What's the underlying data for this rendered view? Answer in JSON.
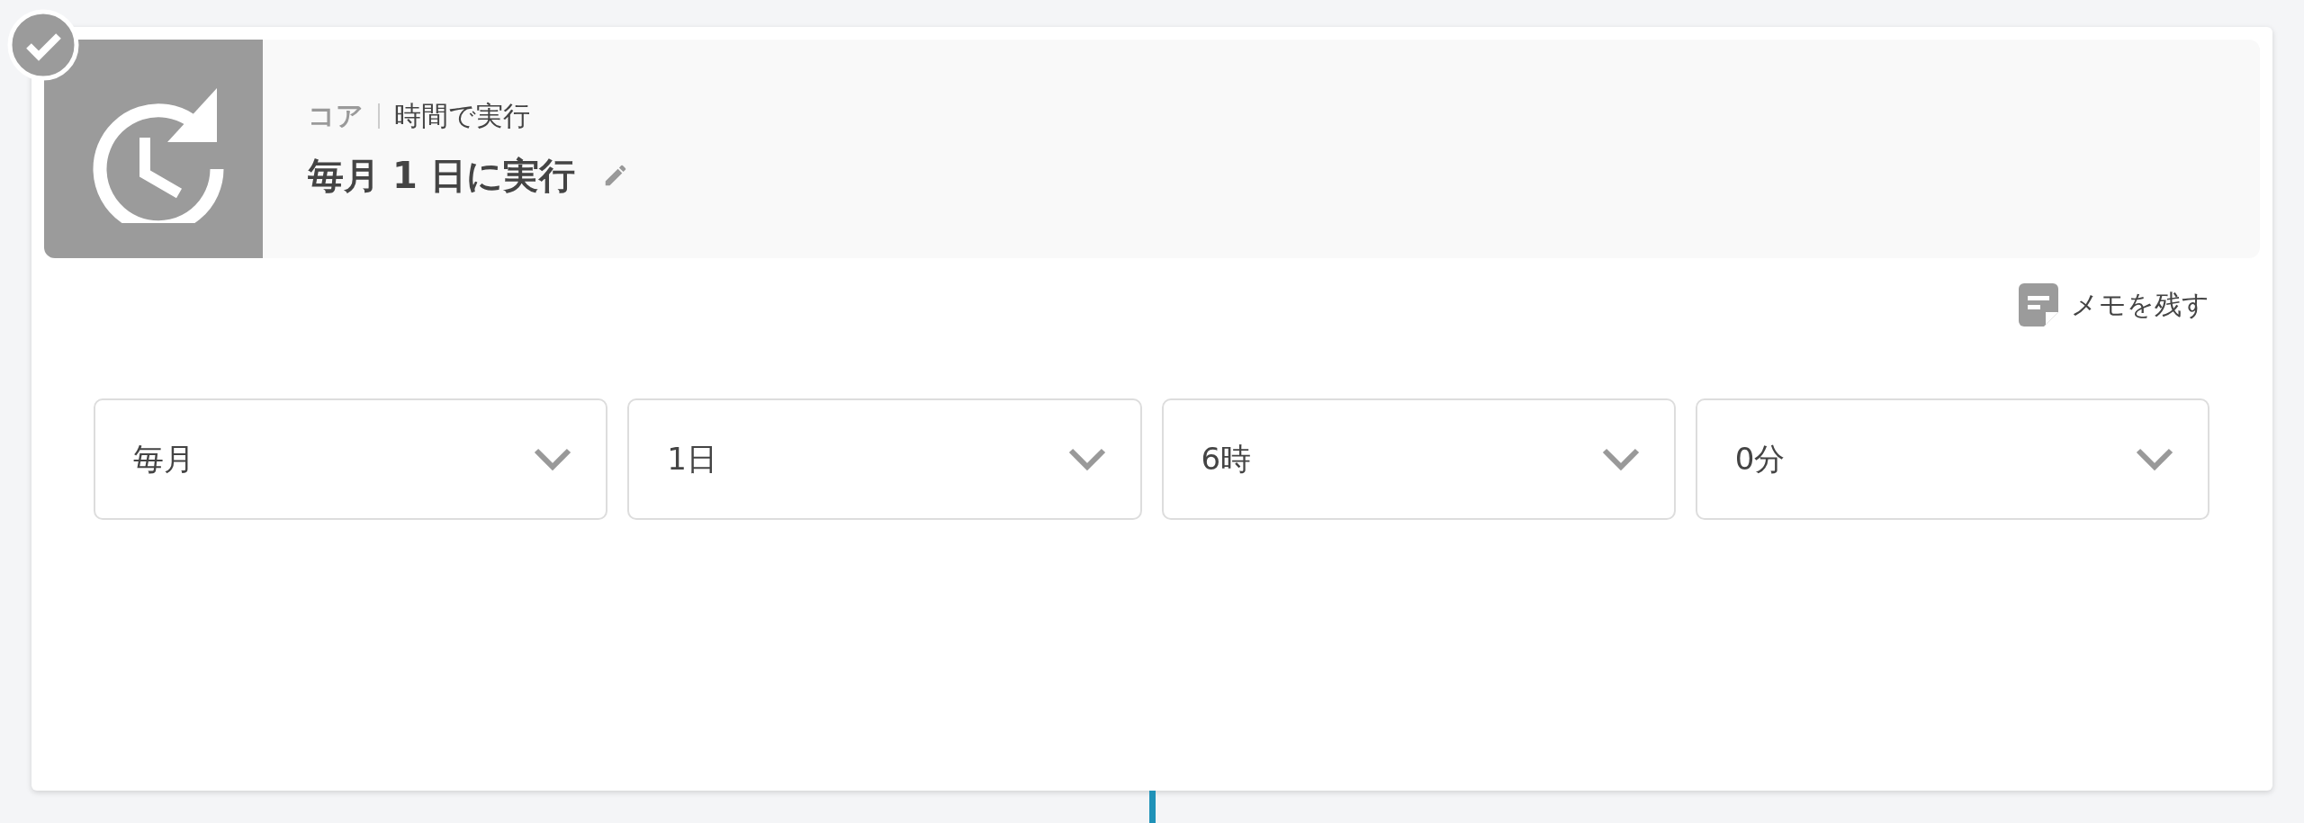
{
  "step": {
    "category": "コア",
    "trigger": "時間で実行",
    "title": "毎月 1 日に実行"
  },
  "memo_link": "メモを残す",
  "selects": [
    {
      "value": "毎月"
    },
    {
      "value": "1日"
    },
    {
      "value": "6時"
    },
    {
      "value": "0分"
    }
  ]
}
